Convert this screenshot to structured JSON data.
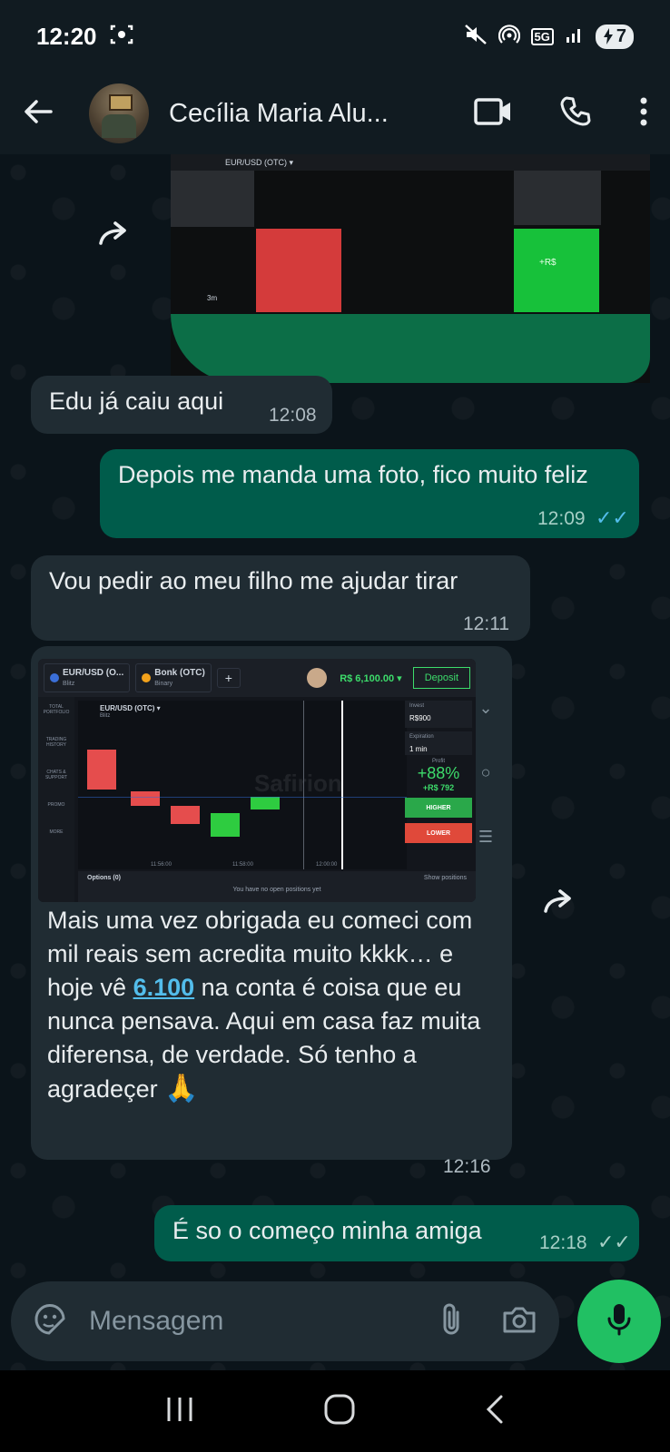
{
  "status_bar": {
    "time": "12:20",
    "network": "5G",
    "battery": "7"
  },
  "header": {
    "contact_name": "Cecília Maria Alu..."
  },
  "messages": {
    "m1": {
      "text": "Edu já caiu aqui",
      "time": "12:08"
    },
    "m2": {
      "text": "Depois me manda uma foto, fico muito feliz",
      "time": "12:09"
    },
    "m3": {
      "text": "Vou pedir ao meu filho me ajudar tirar",
      "time": "12:11"
    },
    "m4": {
      "text_before": "Mais uma vez obrigada eu comeci com mil reais sem acredita muito kkkk… e hoje vê ",
      "link": "6.100",
      "text_after": " na conta é coisa que eu nunca pensava. Aqui em casa faz muita diferensa, de verdade. Só tenho a agradeçer",
      "emoji": "🙏",
      "time": "12:16"
    },
    "m5": {
      "text": "É so o começo minha amiga",
      "time": "12:18"
    }
  },
  "image1": {
    "pair": "EUR/USD (OTC) ▾",
    "label_a": "+R$",
    "label_b": "3m"
  },
  "trade_screen": {
    "tab1": "EUR/USD (O...",
    "tab1_sub": "Blitz",
    "tab2": "Bonk (OTC)",
    "tab2_sub": "Binary",
    "balance": "R$ 6,100.00 ▾",
    "deposit": "Deposit",
    "pair": "EUR/USD (OTC) ▾",
    "pair_sub": "Blitz",
    "invest_label": "Invest",
    "invest_value": "R$900",
    "expiration_label": "Expiration",
    "expiration_value": "1 min",
    "profit_label": "Profit",
    "profit_pct": "+88%",
    "profit_value": "+R$ 792",
    "higher": "HIGHER",
    "lower": "LOWER",
    "watermark": "Safirion",
    "times": [
      "11:56:00",
      "11:58:00",
      "12:00:00"
    ],
    "options_label": "Options (0)",
    "show_positions": "Show positions",
    "no_positions": "You have no open positions yet",
    "side_items": [
      "TOTAL PORTFOLIO",
      "TRADING HISTORY",
      "CHATS & SUPPORT",
      "PROMO",
      "MORE"
    ]
  },
  "input": {
    "placeholder": "Mensagem"
  },
  "colors": {
    "accent": "#21c063",
    "outgoing": "#005c4b",
    "incoming": "#202c33",
    "link": "#53bdeb"
  }
}
